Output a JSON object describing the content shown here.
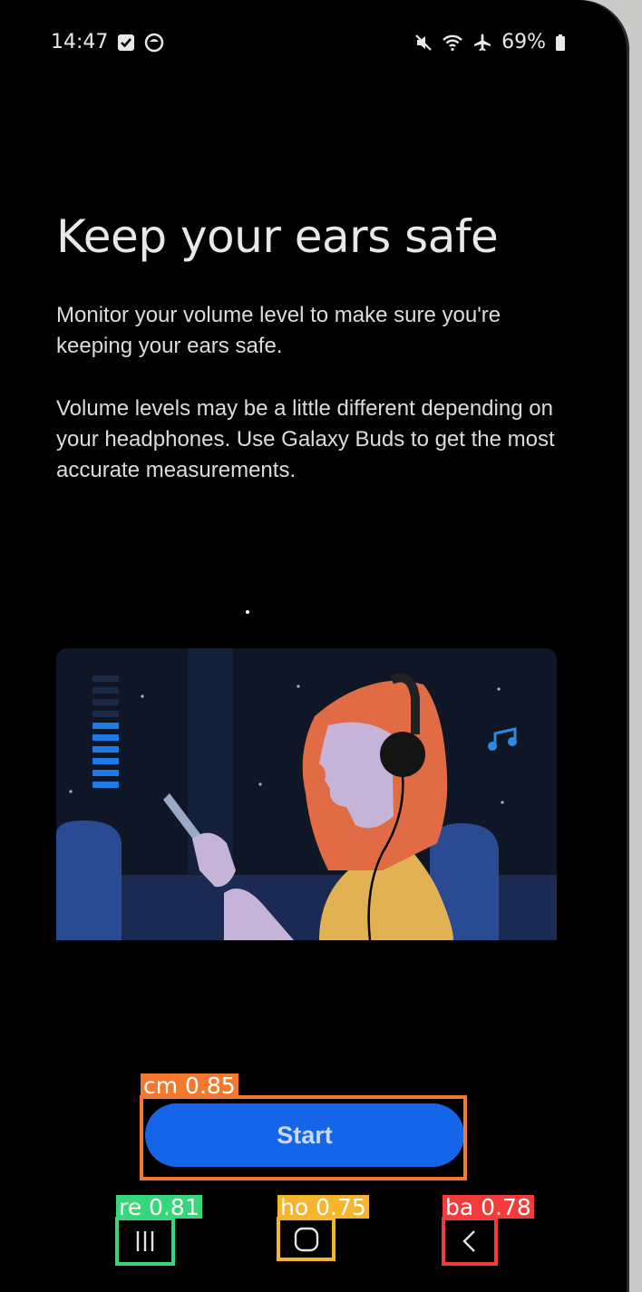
{
  "status_bar": {
    "time": "14:47",
    "battery": "69%"
  },
  "screen": {
    "title": "Keep your ears safe",
    "paragraphs": [
      "Monitor your volume level to make sure you're keeping your ears safe.",
      "Volume levels may be a little different depending on your headphones. Use Galaxy Buds to get the most accurate measurements."
    ]
  },
  "start_button": {
    "label": "Start"
  },
  "detections": [
    {
      "label": "cm 0.85",
      "color": "#f4782e"
    },
    {
      "label": "re 0.81",
      "color": "#37d67a"
    },
    {
      "label": "ho 0.75",
      "color": "#f5b52f"
    },
    {
      "label": "ba 0.78",
      "color": "#f23b3b"
    }
  ],
  "nav_bar": {
    "recents_icon": "recents-icon",
    "home_icon": "home-icon",
    "back_icon": "back-icon"
  },
  "colors": {
    "accent": "#1565e8",
    "hair": "#e06b45",
    "sweater": "#e2b153",
    "skin": "#c6b4d8",
    "music_note": "#2e8ae0"
  }
}
